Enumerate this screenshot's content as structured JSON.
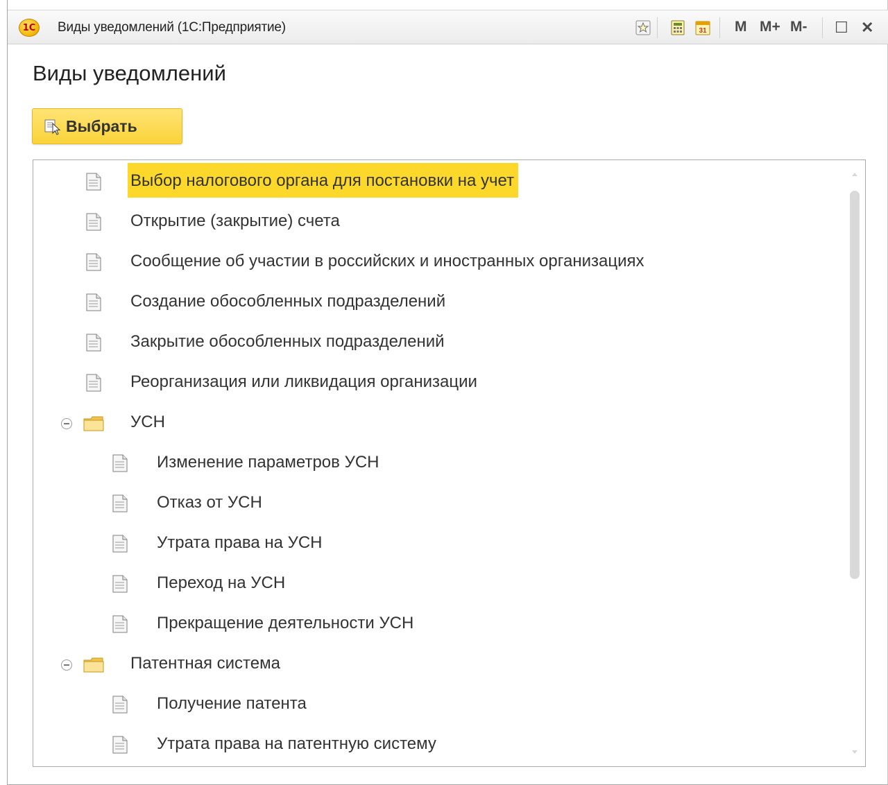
{
  "window": {
    "logo_text": "1С",
    "title": "Виды уведомлений  (1С:Предприятие)",
    "toolbar": {
      "m_label": "M",
      "mplus_label": "M+",
      "mminus_label": "M-",
      "calendar_day": "31",
      "maximize_glyph": "☐",
      "close_glyph": "✕"
    }
  },
  "page": {
    "title": "Виды уведомлений",
    "select_button": "Выбрать"
  },
  "tree": {
    "items": [
      {
        "label": "Выбор налогового органа для постановки на учет",
        "type": "doc",
        "level": 0,
        "selected": true
      },
      {
        "label": "Открытие (закрытие) счета",
        "type": "doc",
        "level": 0
      },
      {
        "label": "Сообщение об участии в российских и иностранных организациях",
        "type": "doc",
        "level": 0
      },
      {
        "label": "Создание обособленных подразделений",
        "type": "doc",
        "level": 0
      },
      {
        "label": "Закрытие обособленных подразделений",
        "type": "doc",
        "level": 0
      },
      {
        "label": "Реорганизация или ликвидация организации",
        "type": "doc",
        "level": 0
      },
      {
        "label": "УСН",
        "type": "folder",
        "level": 0,
        "expanded": true
      },
      {
        "label": "Изменение параметров УСН",
        "type": "doc",
        "level": 1
      },
      {
        "label": "Отказ от УСН",
        "type": "doc",
        "level": 1
      },
      {
        "label": "Утрата права на УСН",
        "type": "doc",
        "level": 1
      },
      {
        "label": "Переход на УСН",
        "type": "doc",
        "level": 1
      },
      {
        "label": "Прекращение деятельности УСН",
        "type": "doc",
        "level": 1
      },
      {
        "label": "Патентная система",
        "type": "folder",
        "level": 0,
        "expanded": true
      },
      {
        "label": "Получение патента",
        "type": "doc",
        "level": 1
      },
      {
        "label": "Утрата права на патентную систему",
        "type": "doc",
        "level": 1
      }
    ]
  },
  "colors": {
    "accent": "#fcd82a",
    "button": "#f9d338"
  }
}
